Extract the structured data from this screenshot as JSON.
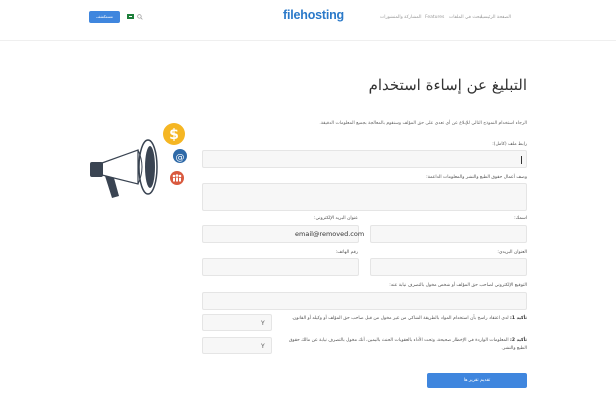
{
  "header": {
    "button_label": "مستكشف",
    "logo": "filehosting",
    "nav": [
      "الصفحة الرئيسية",
      "ابحث في الملفات",
      "Features",
      "المشاركة والمنشورات"
    ]
  },
  "page": {
    "title": "التبليغ عن إساءة استخدام",
    "intro": "الرجاء استخدام النموذج التالي للإبلاغ عن أي تعدي على حق المؤلف وسنقوم بالمعالجة بجميع المعلومات الدقيقة."
  },
  "form": {
    "link_label": "رابط ملف (كامل):",
    "description_label": "وصف أعمال حقوق الطبع والنشر والمعلومات الداعمة:",
    "name_label": "اسمك:",
    "email_label": "عنوان البريد الإلكتروني:",
    "email_value": "email@removed.com",
    "address_label": "العنوان البريدي:",
    "phone_label": "رقم الهاتف:",
    "signature_label": "التوقيع الإلكتروني لصاحب حق المؤلف أو شخص مخول بالتصرف نيابة عنه:",
    "confirm1_prefix": "تأكيد 1:",
    "confirm1_text": "لدي اعتقاد راسخ بأن استخدام المواد بالطريقة الشاكي من غير مخول من قبل صاحب حق المؤلف أو وكيله أو القانون.",
    "confirm2_prefix": "تأكيد 2:",
    "confirm2_text": "المعلومات الواردة في الإخطار صحيحة، وتحت الأداء بالعقوبات الحنث باليمين، أنك مخول بالتصرف نيابة عن مالك حقوق الطبع والنشر.",
    "check1": "Y",
    "check2": "Y",
    "submit_label": "تقديم تقرير ها"
  },
  "colors": {
    "accent": "#3f86de",
    "coin": "#f5b623",
    "at_badge": "#2f6aa8",
    "people_badge": "#d95a3f",
    "megaphone": "#3a4452"
  },
  "icons": [
    "search-icon",
    "flag-icon",
    "megaphone-icon",
    "dollar-icon",
    "at-icon",
    "people-icon"
  ]
}
